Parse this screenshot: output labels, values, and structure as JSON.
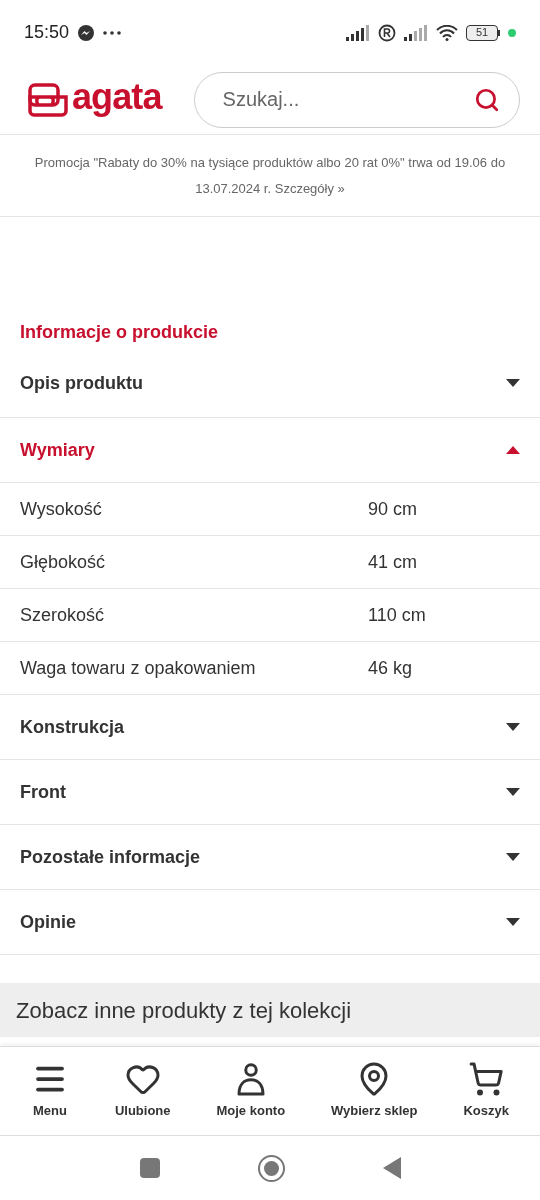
{
  "status_bar": {
    "time": "15:50",
    "battery": "51"
  },
  "header": {
    "logo": "agata",
    "search": {
      "placeholder": "Szukaj..."
    }
  },
  "promo": {
    "text": "Promocja \"Rabaty do 30% na tysiące produktów albo 20 rat 0%\" trwa od 19.06 do 13.07.2024 r.",
    "link": "Szczegóły »"
  },
  "section_title": "Informacje o produkcie",
  "accordion": [
    {
      "title": "Opis produktu",
      "expanded": false
    },
    {
      "title": "Wymiary",
      "expanded": true,
      "rows": [
        {
          "label": "Wysokość",
          "value": "90 cm"
        },
        {
          "label": "Głębokość",
          "value": "41 cm"
        },
        {
          "label": "Szerokość",
          "value": "110 cm"
        },
        {
          "label": "Waga towaru z opakowaniem",
          "value": "46 kg"
        }
      ]
    },
    {
      "title": "Konstrukcja",
      "expanded": false
    },
    {
      "title": "Front",
      "expanded": false
    },
    {
      "title": "Pozostałe informacje",
      "expanded": false
    },
    {
      "title": "Opinie",
      "expanded": false
    }
  ],
  "collection_heading": "Zobacz inne produkty z tej kolekcji",
  "bottom_nav": [
    {
      "kind": "menu",
      "label": "Menu"
    },
    {
      "kind": "heart",
      "label": "Ulubione"
    },
    {
      "kind": "account",
      "label": "Moje konto"
    },
    {
      "kind": "pin",
      "label": "Wybierz sklep"
    },
    {
      "kind": "cart",
      "label": "Koszyk"
    }
  ]
}
